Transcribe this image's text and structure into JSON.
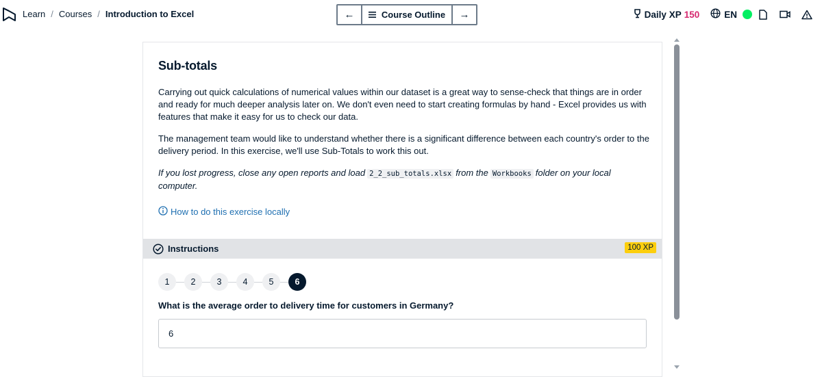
{
  "header": {
    "breadcrumb": [
      {
        "label": "Learn"
      },
      {
        "label": "Courses"
      },
      {
        "label": "Introduction to Excel"
      }
    ],
    "course_outline_label": "Course Outline",
    "daily_xp_label": "Daily XP",
    "daily_xp_value": "150",
    "language": "EN"
  },
  "exercise": {
    "title": "Sub-totals",
    "paragraph1": "Carrying out quick calculations of numerical values within our dataset is a great way to sense-check that things are in order and ready for much deeper analysis later on. We don't even need to start creating formulas by hand - Excel provides us with features that make it easy for us to check our data.",
    "paragraph2": "The management team would like to understand whether there is a significant difference between each country's order to the delivery period. In this exercise, we'll use Sub-Totals to work this out.",
    "note_part1": "If you lost progress, close any open reports and load",
    "note_file": "2_2_sub_totals.xlsx",
    "note_part2": "from the",
    "note_folder": "Workbooks",
    "note_part3": "folder on your local computer.",
    "local_link": "How to do this exercise locally"
  },
  "instructions": {
    "label": "Instructions",
    "xp_badge": "100 XP",
    "steps": [
      "1",
      "2",
      "3",
      "4",
      "5",
      "6"
    ],
    "active_step": "6",
    "question": "What is the average order to delivery time for customers in Germany?",
    "answer_value": "6"
  },
  "colors": {
    "accent_xp": "#d5286e",
    "status_online": "#03ef62",
    "xp_badge": "#fcce0d",
    "navy": "#05192d",
    "link": "#1e6fb1"
  }
}
